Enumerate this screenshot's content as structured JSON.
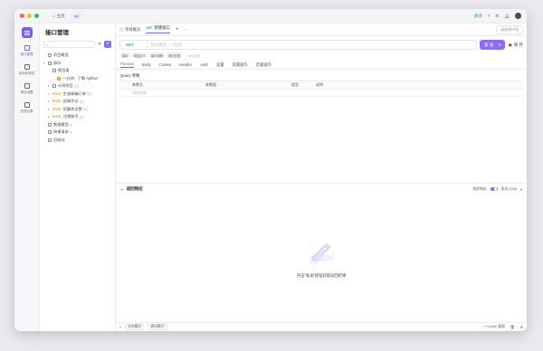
{
  "titlebar": {
    "home_label": "主页",
    "project_pill": "api",
    "invite_label": "邀请",
    "colors": {
      "close": "#ff5f57",
      "minimize": "#febc2e",
      "maximize": "#28c840"
    }
  },
  "iconbar": {
    "items": [
      {
        "label": "接口管理",
        "icon": "api-icon"
      },
      {
        "label": "自动化测试",
        "icon": "test-icon"
      },
      {
        "label": "项目设置",
        "icon": "settings-icon"
      },
      {
        "label": "在线分享",
        "icon": "share-icon"
      }
    ]
  },
  "sidebar": {
    "title": "接口管理",
    "tree": [
      {
        "label": "项目概览",
        "indent": 0
      },
      {
        "label": "接口",
        "indent": 0,
        "caret": "▾"
      },
      {
        "label": "根目录",
        "indent": 1
      },
      {
        "label": "一分钟，了解 Apifox！",
        "indent": 2
      },
      {
        "label": "示例项目",
        "count": "(4)",
        "indent": 1,
        "caret": "▸"
      },
      {
        "label": "生成邮箱订单",
        "method": "POST",
        "count": "(1)",
        "indent": 1,
        "caret": "▸"
      },
      {
        "label": "创建评论",
        "method": "POST",
        "count": "(1)",
        "indent": 1,
        "caret": "▸"
      },
      {
        "label": "招募热点赞",
        "method": "POST",
        "count": "(1)",
        "indent": 1,
        "caret": "▸"
      },
      {
        "label": "注销账号",
        "method": "POST",
        "count": "(1)",
        "indent": 1,
        "caret": "▸"
      },
      {
        "label": "数据模型",
        "indent": 0,
        "caret": "▸"
      },
      {
        "label": "快捷请求",
        "indent": 0,
        "caret": "▸"
      },
      {
        "label": "回收站",
        "indent": 0
      }
    ]
  },
  "tabs": [
    {
      "label": "项目概览",
      "method": ""
    },
    {
      "label": "新建接口",
      "method": "GET"
    }
  ],
  "env_select": "请选择环境",
  "request": {
    "method": "GET",
    "url_placeholder": "接口路径，\"/\"起始",
    "send_label": "发 送",
    "save_label": "保 存",
    "chips": [
      "填本",
      "响应定义",
      "接口说明",
      "测试文档"
    ],
    "chip_placeholder": "+ 添加标签"
  },
  "req_tabs": [
    "Params",
    "Body",
    "Cookie",
    "Header",
    "Auth",
    "设置",
    "前置操作",
    "后置操作"
  ],
  "query_params": {
    "title": "Query 参数",
    "headers": [
      "参数名",
      "参数值",
      "类型",
      "说明"
    ],
    "row_placeholder": "添加参数"
  },
  "response": {
    "title": "返回响应",
    "validate_label": "校验响应",
    "status_label": "成功 (200)",
    "empty_text": "点击\"发送\"按钮获取返回结果"
  },
  "statusbar": {
    "left": [
      "文档模式",
      "调试模式"
    ],
    "right": [
      "Cookie 管理"
    ]
  }
}
